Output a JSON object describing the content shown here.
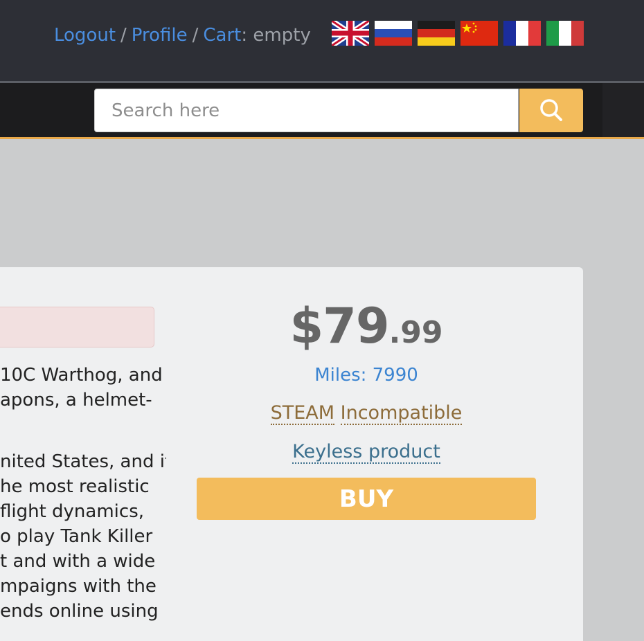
{
  "header": {
    "logout_label": "Logout",
    "profile_label": "Profile",
    "cart_label": "Cart",
    "cart_value": "empty",
    "separator": "/",
    "languages": [
      "en-flag-icon",
      "ru-flag-icon",
      "de-flag-icon",
      "cn-flag-icon",
      "fr-flag-icon",
      "it-flag-icon"
    ]
  },
  "search": {
    "placeholder": "Search here",
    "button_icon": "search-icon"
  },
  "product": {
    "description_lines": [
      "10C Warthog, and",
      "apons, a helmet-",
      "",
      "nited States, and it",
      "he most realistic",
      "flight dynamics,",
      "o play Tank Killer",
      "t and with a wide",
      "mpaigns with the",
      "ends online using"
    ],
    "price_main": "$79",
    "price_cents": ".99",
    "miles_text": "Miles: 7990",
    "platform": "STEAM",
    "compatibility": "Incompatible",
    "key_type": "Keyless product",
    "buy_label": "BUY"
  },
  "colors": {
    "accent": "#f3bc5c",
    "link": "#4a8ee0",
    "header_bg": "#2d2f36"
  }
}
